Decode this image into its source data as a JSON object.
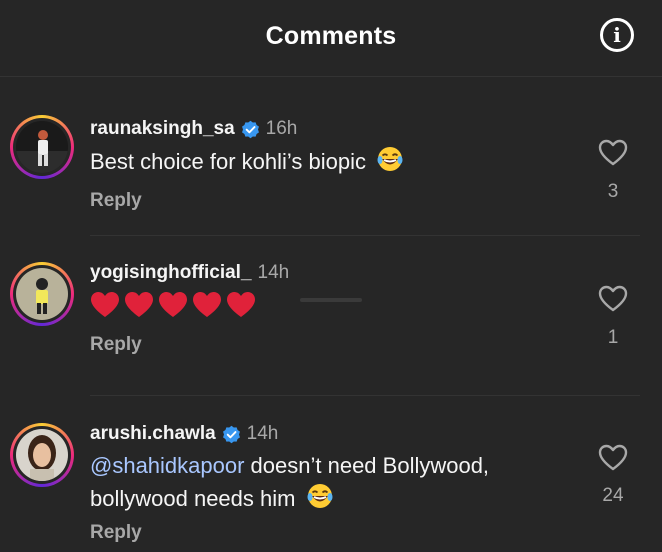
{
  "header": {
    "title": "Comments",
    "info_icon": "info-circle-icon"
  },
  "comments": [
    {
      "username": "raunaksingh_sa",
      "verified": true,
      "time": "16h",
      "text": "Best choice for kohli’s biopic",
      "emoji": "laughing-tears-emoji",
      "reply_label": "Reply",
      "likes": "3"
    },
    {
      "username": "yogisinghofficial_",
      "verified": false,
      "time": "14h",
      "text": "",
      "emoji": "red-heart-emoji",
      "emoji_count": 5,
      "reply_label": "Reply",
      "likes": "1"
    },
    {
      "username": "arushi.chawla",
      "verified": true,
      "time": "14h",
      "mention": "@shahidkapoor",
      "text": " doesn’t need Bollywood, bollywood needs him",
      "emoji": "laughing-tears-emoji",
      "reply_label": "Reply",
      "likes": "24"
    }
  ],
  "colors": {
    "background": "#262626",
    "text_primary": "#f5f5f5",
    "text_secondary": "#a8a8a8",
    "mention": "#a9c7ff",
    "verified_badge": "#3897f0",
    "heart": "#e0223a"
  }
}
